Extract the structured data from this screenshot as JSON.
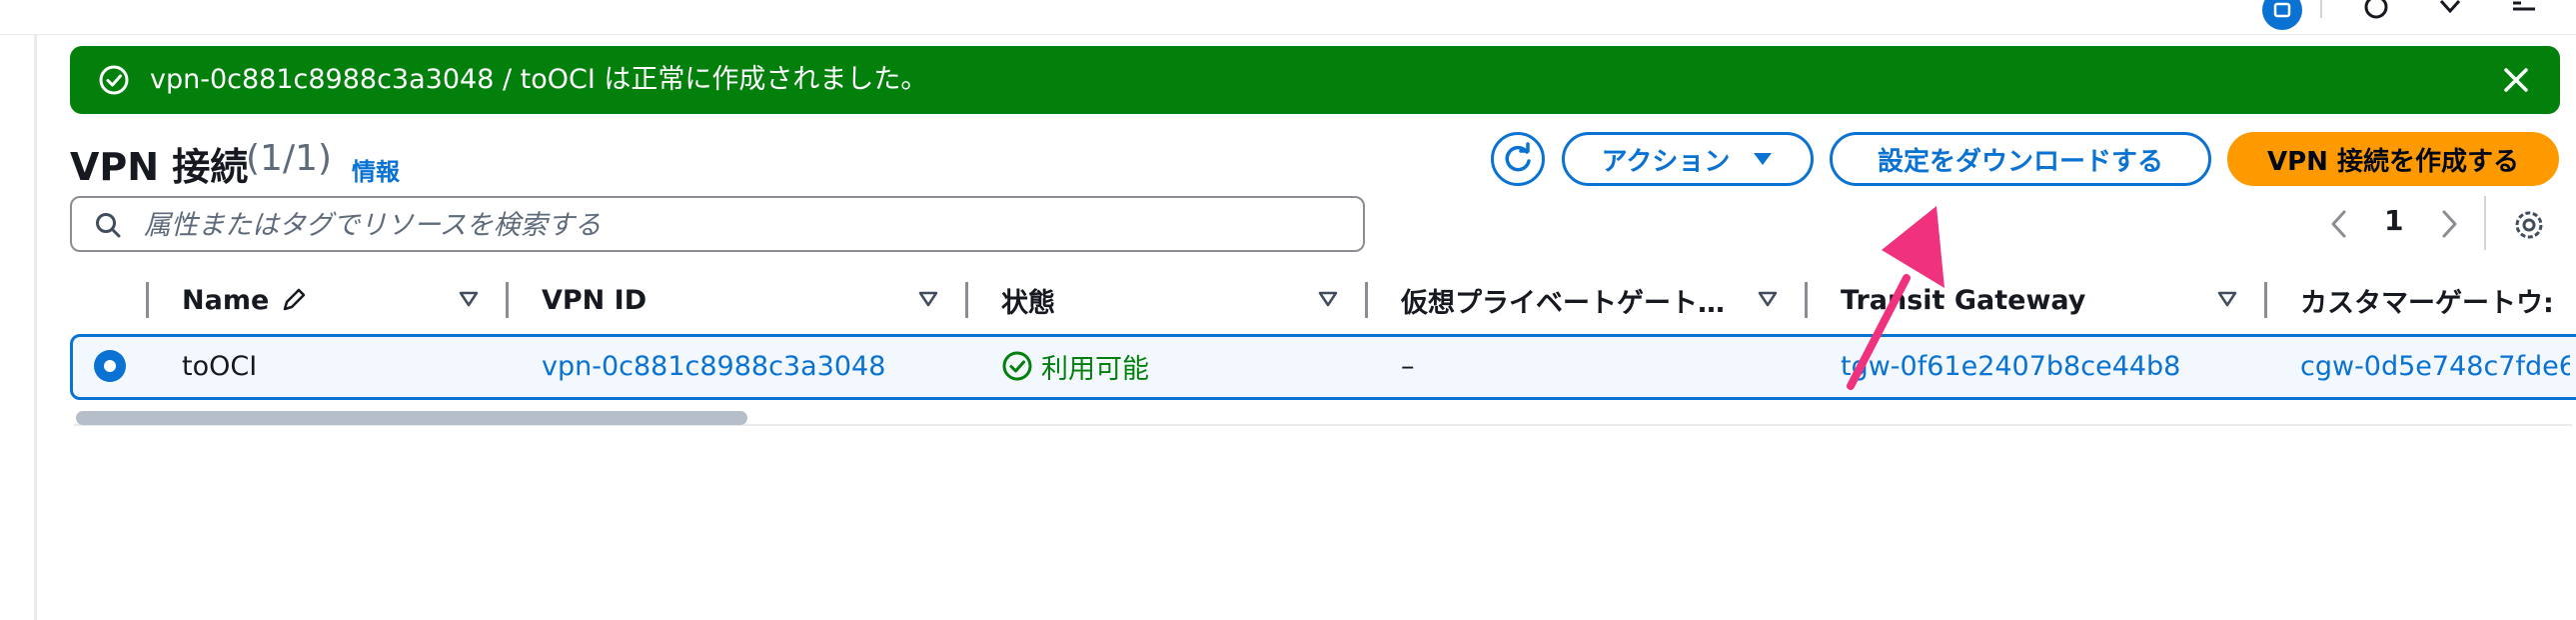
{
  "colors": {
    "accent": "#0972d3",
    "success": "#037f0c",
    "primary_button": "#ff9900",
    "annotation_arrow": "#f0327e"
  },
  "flash": {
    "message": "vpn-0c881c8988c3a3048 / toOCI は正常に作成されました。",
    "status_icon": "check-circle-icon",
    "dismiss_icon": "close-icon"
  },
  "header": {
    "title": "VPN 接続",
    "count": "(1/1)",
    "info_link": "情報"
  },
  "toolbar": {
    "refresh_icon": "refresh-icon",
    "actions_label": "アクション",
    "download_label": "設定をダウンロードする",
    "create_label": "VPN 接続を作成する"
  },
  "search": {
    "placeholder": "属性またはタグでリソースを検索する",
    "value": ""
  },
  "pagination": {
    "current_page": "1"
  },
  "table": {
    "columns": [
      {
        "label": "Name"
      },
      {
        "label": "VPN ID"
      },
      {
        "label": "状態"
      },
      {
        "label": "仮想プライベートゲート…"
      },
      {
        "label": "Transit Gateway"
      },
      {
        "label": "カスタマーゲートウ:"
      }
    ],
    "rows": [
      {
        "selected": true,
        "name": "toOCI",
        "vpn_id": "vpn-0c881c8988c3a3048",
        "state": "利用可能",
        "vgw": "–",
        "tgw": "tgw-0f61e2407b8ce44b8",
        "cgw": "cgw-0d5e748c7fde6"
      }
    ]
  }
}
